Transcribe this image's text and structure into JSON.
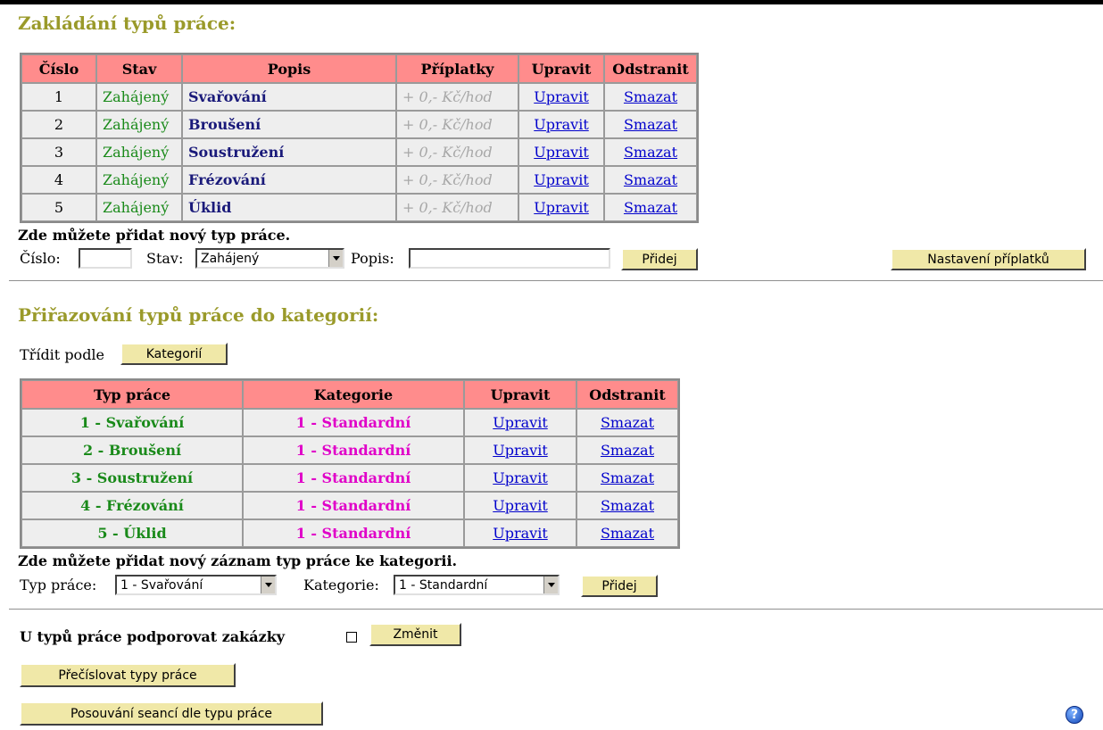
{
  "work_types_section": {
    "title": "Zakládání typů práce:",
    "table": {
      "headers": [
        "Číslo",
        "Stav",
        "Popis",
        "Příplatky",
        "Upravit",
        "Odstranit"
      ],
      "rows": [
        {
          "number": "1",
          "state": "Zahájený",
          "desc": "Svařování",
          "surcharge": "+ 0,- Kč/hod",
          "edit": "Upravit",
          "delete": "Smazat"
        },
        {
          "number": "2",
          "state": "Zahájený",
          "desc": "Broušení",
          "surcharge": "+ 0,- Kč/hod",
          "edit": "Upravit",
          "delete": "Smazat"
        },
        {
          "number": "3",
          "state": "Zahájený",
          "desc": "Soustružení",
          "surcharge": "+ 0,- Kč/hod",
          "edit": "Upravit",
          "delete": "Smazat"
        },
        {
          "number": "4",
          "state": "Zahájený",
          "desc": "Frézování",
          "surcharge": "+ 0,- Kč/hod",
          "edit": "Upravit",
          "delete": "Smazat"
        },
        {
          "number": "5",
          "state": "Zahájený",
          "desc": "Úklid",
          "surcharge": "+ 0,- Kč/hod",
          "edit": "Upravit",
          "delete": "Smazat"
        }
      ]
    },
    "add_hint": "Zde můžete přidat nový typ práce.",
    "form": {
      "number_label": "Číslo:",
      "number_value": "",
      "state_label": "Stav:",
      "state_value": "Zahájený",
      "desc_label": "Popis:",
      "desc_value": "",
      "add_button": "Přidej",
      "surcharge_settings_button": "Nastavení příplatků"
    }
  },
  "category_section": {
    "title": "Přiřazování typů práce do kategorií:",
    "sort_label": "Třídit podle",
    "sort_button": "Kategorií",
    "table": {
      "headers": [
        "Typ práce",
        "Kategorie",
        "Upravit",
        "Odstranit"
      ],
      "rows": [
        {
          "work_type": "1 - Svařování",
          "category": "1 - Standardní",
          "edit": "Upravit",
          "delete": "Smazat"
        },
        {
          "work_type": "2 - Broušení",
          "category": "1 - Standardní",
          "edit": "Upravit",
          "delete": "Smazat"
        },
        {
          "work_type": "3 - Soustružení",
          "category": "1 - Standardní",
          "edit": "Upravit",
          "delete": "Smazat"
        },
        {
          "work_type": "4 - Frézování",
          "category": "1 - Standardní",
          "edit": "Upravit",
          "delete": "Smazat"
        },
        {
          "work_type": "5 - Úklid",
          "category": "1 - Standardní",
          "edit": "Upravit",
          "delete": "Smazat"
        }
      ]
    },
    "add_hint": "Zde můžete přidat nový záznam typ práce ke kategorii.",
    "form": {
      "work_type_label": "Typ práce:",
      "work_type_value": "1 - Svařování",
      "category_label": "Kategorie:",
      "category_value": "1 - Standardní",
      "add_button": "Přidej"
    }
  },
  "orders_support": {
    "label": "U typů práce podporovat zakázky",
    "checked": false,
    "change_button": "Změnit"
  },
  "renumber_button": "Přečíslovat typy práce",
  "shift_sessions_button": "Posouvání seancí dle typu práce",
  "help_icon": "question-mark-icon",
  "colors": {
    "title": "#9a9a2a",
    "header_bg": "#ff8c8c",
    "state_green": "#1a8a1a",
    "desc_navy": "#1a1a7a",
    "category_magenta": "#e000c8",
    "link_blue": "#0000cc",
    "button_bg": "#f0e8a8"
  }
}
